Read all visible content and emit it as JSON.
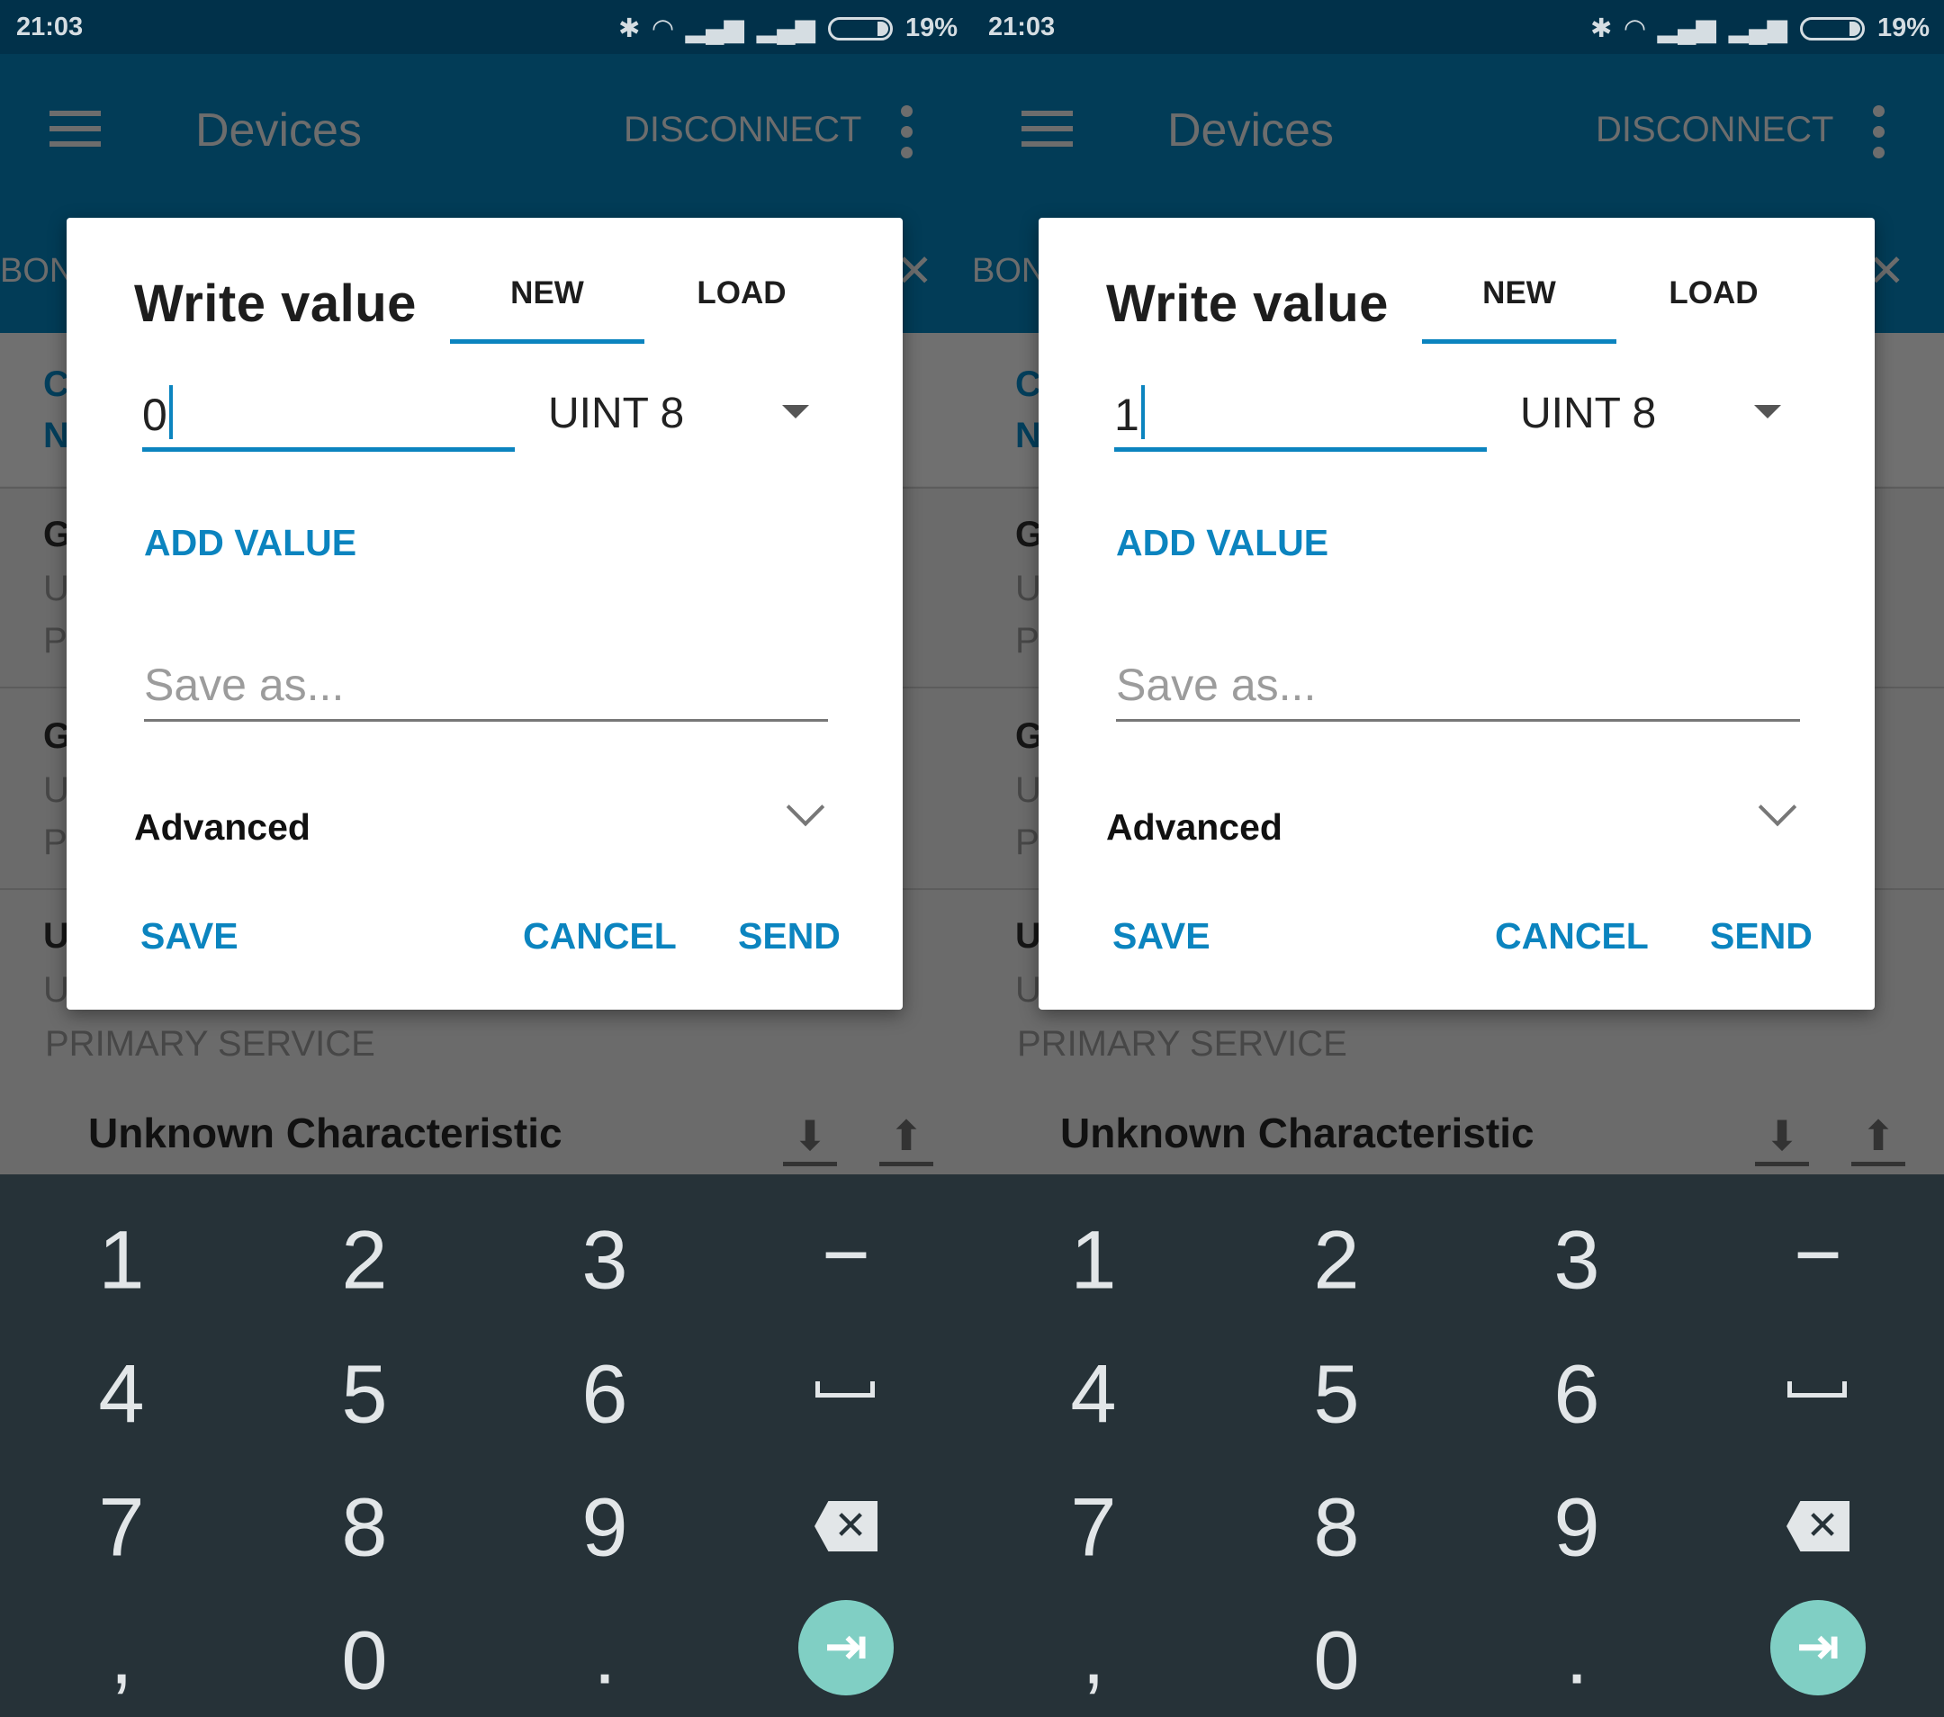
{
  "status_bar": {
    "time": "21:03",
    "battery": "19%",
    "icons": [
      "bluetooth-icon",
      "wifi-icon",
      "signal-icon",
      "signal-icon",
      "battery-icon"
    ]
  },
  "app_bar": {
    "title": "Devices",
    "disconnect": "DISCONNECT",
    "tab_partial": "BON"
  },
  "background_list": {
    "clipped_letters": [
      "C",
      "N",
      "G",
      "U",
      "P",
      "G",
      "U",
      "P",
      "U",
      "U"
    ],
    "primary_service": "PRIMARY SERVICE",
    "characteristic": "Unknown Characteristic"
  },
  "dialog": {
    "title": "Write value",
    "tabs": [
      {
        "label": "NEW",
        "active": true
      },
      {
        "label": "LOAD",
        "active": false
      }
    ],
    "type": "UINT 8",
    "add_value": "ADD VALUE",
    "save_as_placeholder": "Save as...",
    "advanced": "Advanced",
    "save": "SAVE",
    "cancel": "CANCEL",
    "send": "SEND"
  },
  "panels": [
    {
      "value": "0"
    },
    {
      "value": "1"
    }
  ],
  "keyboard": {
    "keys": [
      "1",
      "2",
      "3",
      "−",
      "4",
      "5",
      "6",
      "␣",
      "7",
      "8",
      "9",
      "⌫",
      ",",
      "0",
      ".",
      "⇥"
    ]
  },
  "colors": {
    "accent": "#0b84bf",
    "app_bar": "#023c57",
    "keyboard": "#263238",
    "enter_key": "#80cfc4"
  }
}
